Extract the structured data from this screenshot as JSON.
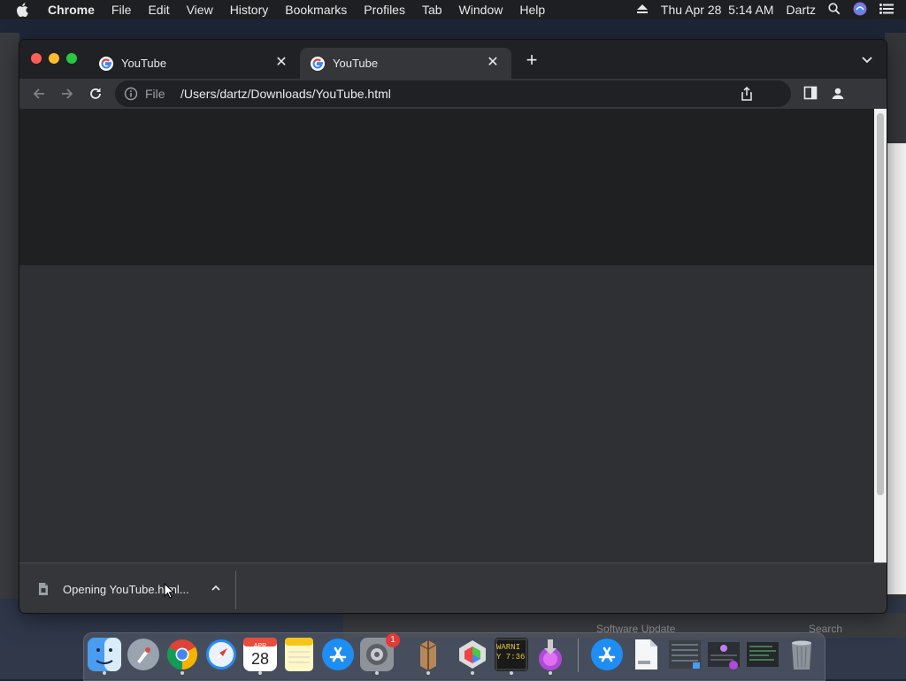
{
  "menubar": {
    "items": [
      "Chrome",
      "File",
      "Edit",
      "View",
      "History",
      "Bookmarks",
      "Profiles",
      "Tab",
      "Window",
      "Help"
    ],
    "datetime": "Thu Apr 28  5:14 AM",
    "user": "Dartz"
  },
  "browser": {
    "tabs": [
      {
        "title": "YouTube",
        "active": false
      },
      {
        "title": "YouTube",
        "active": true
      }
    ],
    "omnibox": {
      "scheme": "File",
      "url": "/Users/dartz/Downloads/YouTube.html"
    },
    "download": {
      "label": "Opening YouTube.html..."
    }
  },
  "background": {
    "bottom_window_title": "Software Update",
    "bottom_search": "Search"
  },
  "dock": {
    "calendar_month": "APR",
    "calendar_day": "28",
    "system_prefs_badge": "1",
    "console_text_1": "WARNI",
    "console_text_2": "Y 7:36",
    "items": [
      "finder",
      "launchpad",
      "chrome",
      "safari",
      "calendar",
      "notes",
      "app-store",
      "system-preferences",
      "archive-utility",
      "colorsync",
      "console",
      "installer",
      "app-store-download",
      "html-file",
      "screenshot-1",
      "screenshot-2",
      "screenshot-3",
      "trash"
    ]
  },
  "colors": {
    "chrome_dark": "#202124",
    "toolbar": "#35363a",
    "traffic_red": "#ff5f57",
    "traffic_yellow": "#febc2e",
    "traffic_green": "#28c840"
  }
}
